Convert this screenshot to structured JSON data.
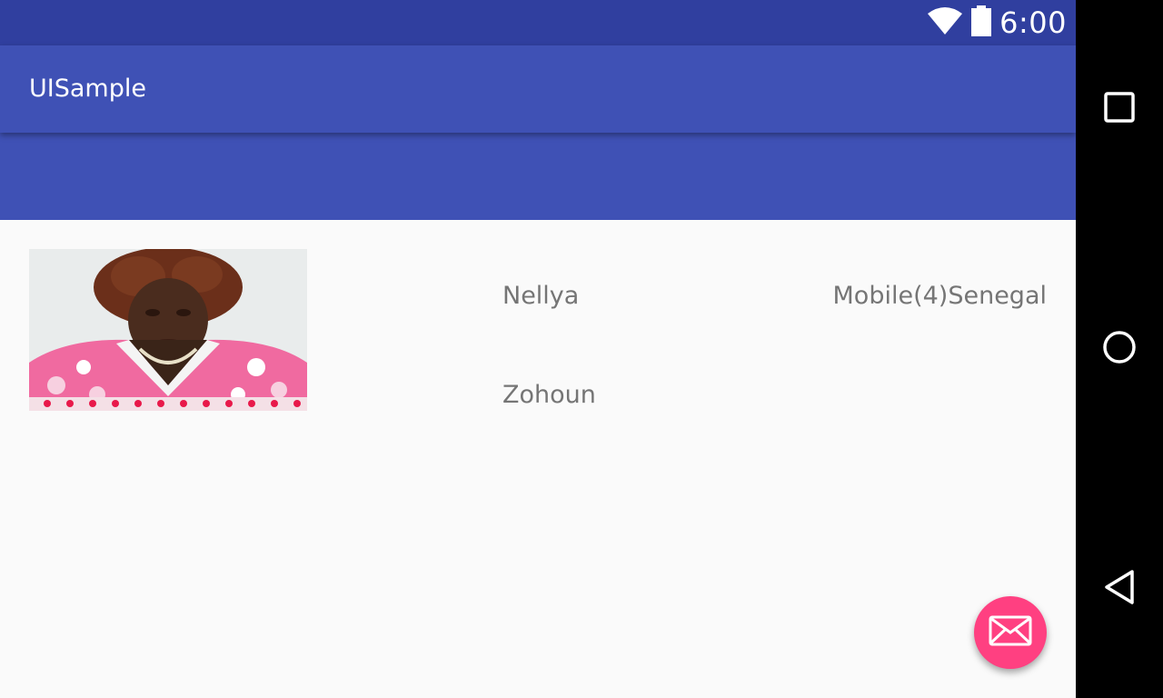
{
  "status_bar": {
    "time": "6:00",
    "icons": [
      "wifi-icon",
      "battery-icon"
    ],
    "color": "#303f9f"
  },
  "app_bar": {
    "title": "UISample",
    "color": "#3f51b5"
  },
  "contact": {
    "photo": "person-photo",
    "first_name": "Nellya",
    "last_name": "Zohoun",
    "phone_label": "Mobile(4)Senegal"
  },
  "fab": {
    "icon": "mail-icon",
    "color": "#ff4081"
  },
  "nav_bar": {
    "buttons": [
      "recents-icon",
      "home-icon",
      "back-icon"
    ]
  }
}
